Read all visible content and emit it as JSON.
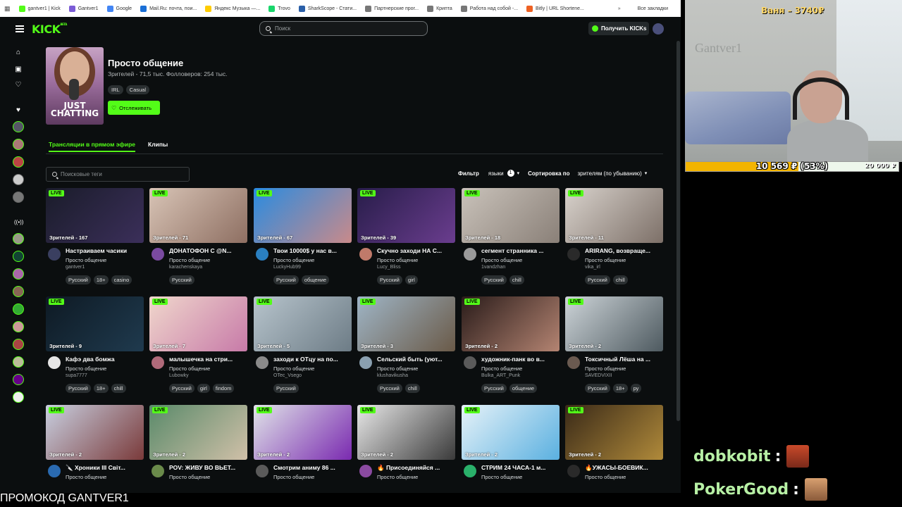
{
  "browser": {
    "bookmarks": [
      {
        "label": "gantver1 | Kick",
        "color": "#53fc18"
      },
      {
        "label": "Gantver1",
        "color": "#7b5cd6"
      },
      {
        "label": "Google",
        "color": "#4285f4"
      },
      {
        "label": "Mail.Ru: почта, пои...",
        "color": "#1a6fd6"
      },
      {
        "label": "Яндекс Музыка —...",
        "color": "#ffcc00"
      },
      {
        "label": "Trovo",
        "color": "#19d66b"
      },
      {
        "label": "SharkScope - Стати...",
        "color": "#2a5fa8"
      },
      {
        "label": "Партнерские прог...",
        "color": "#777777"
      },
      {
        "label": "Крипта",
        "color": "#777777"
      },
      {
        "label": "Работа над собой -...",
        "color": "#777777"
      },
      {
        "label": "Bitly | URL Shortene...",
        "color": "#ee6123"
      }
    ],
    "all_bookmarks": "Все закладки"
  },
  "header": {
    "search_placeholder": "Поиск",
    "kicks_button": "Получить KICKs"
  },
  "category": {
    "title": "Просто общение",
    "stats": "Зрителей - 71,5 тыс.  Фолловеров: 254 тыс.",
    "tags": [
      "IRL",
      "Casual"
    ],
    "follow_button": "Отслеживать",
    "image_text": "JUST CHATTING"
  },
  "tabs": {
    "live": "Трансляции в прямом эфире",
    "clips": "Клипы"
  },
  "filters": {
    "tag_search_placeholder": "Поисковые теги",
    "filter_label": "Фильтр",
    "languages_label": "языки",
    "languages_count": "1",
    "sort_label": "Сортировка по",
    "sort_value": "зрителям (по убыванию)"
  },
  "live_badge": "LIVE",
  "streams": [
    {
      "viewers": "Зрителей - 167",
      "title": "Настраиваем часики",
      "category": "Просто общение",
      "user": "gantver1",
      "tags": [
        "Русский",
        "18+",
        "casino"
      ],
      "thumb": [
        "#1a1c2a",
        "#3b2f5a"
      ],
      "avatar": "#3a3f60"
    },
    {
      "viewers": "Зрителей - 71",
      "title": "ДОНАТОФОН С @N...",
      "category": "Просто общение",
      "user": "karachenskaya",
      "tags": [
        "Русский"
      ],
      "thumb": [
        "#d8c4b6",
        "#8e6f62"
      ],
      "avatar": "#7a4aa0"
    },
    {
      "viewers": "Зрителей - 67",
      "title": "Твои 10000$ у нас в...",
      "category": "Просто общение",
      "user": "LuckyHub99",
      "tags": [
        "Русский",
        "общение"
      ],
      "thumb": [
        "#2a8be0",
        "#c98a8a"
      ],
      "avatar": "#2a7fc0"
    },
    {
      "viewers": "Зрителей - 39",
      "title": "Скучно заходи НА С...",
      "category": "Просто общение",
      "user": "Lucy_Bliss",
      "tags": [
        "Русский",
        "girl"
      ],
      "thumb": [
        "#281d4a",
        "#6a3d8e"
      ],
      "avatar": "#c07a6a"
    },
    {
      "viewers": "Зрителей - 18",
      "title": "сегмент странника ...",
      "category": "Просто общение",
      "user": "1vandzhan",
      "tags": [
        "Русский",
        "chill"
      ],
      "thumb": [
        "#c9c2ba",
        "#8a8078"
      ],
      "avatar": "#9a9a9a"
    },
    {
      "viewers": "Зрителей - 11",
      "title": "ARIRANG, возвраще...",
      "category": "Просто общение",
      "user": "vika_irl",
      "tags": [
        "Русский",
        "chill"
      ],
      "thumb": [
        "#d8d2cc",
        "#7d7068"
      ],
      "avatar": "#2a2a2a"
    },
    {
      "viewers": "Зрителей - 9",
      "title": "Кафэ два бомжа",
      "category": "Просто общение",
      "user": "supa7777",
      "tags": [
        "Русский",
        "18+",
        "chill"
      ],
      "thumb": [
        "#0e1a24",
        "#1f3a4e"
      ],
      "avatar": "#e6e6e6"
    },
    {
      "viewers": "Зрителей - 7",
      "title": "малышечка на стри...",
      "category": "Просто общение",
      "user": "Lubowky",
      "tags": [
        "Русский",
        "girl",
        "findom"
      ],
      "thumb": [
        "#f0d7cc",
        "#c77aa8"
      ],
      "avatar": "#b06a7a"
    },
    {
      "viewers": "Зрителей - 5",
      "title": "заходи к ОТцу на по...",
      "category": "Просто общение",
      "user": "OTec_Vsego",
      "tags": [
        "Русский"
      ],
      "thumb": [
        "#b7c4cc",
        "#6d7c86"
      ],
      "avatar": "#8a8a8a"
    },
    {
      "viewers": "Зрителей - 3",
      "title": "Сельский быть (уют...",
      "category": "Просто общение",
      "user": "klushavikusha",
      "tags": [
        "Русский",
        "chill"
      ],
      "thumb": [
        "#9fb5c6",
        "#6a5a48"
      ],
      "avatar": "#8aa0b0"
    },
    {
      "viewers": "Зрителей - 2",
      "title": "художник-панк во в...",
      "category": "Просто общение",
      "user": "Bulka_ART_Punk",
      "tags": [
        "Русский",
        "общение"
      ],
      "thumb": [
        "#2a1c1a",
        "#b48472"
      ],
      "avatar": "#5a5a5a"
    },
    {
      "viewers": "Зрителей - 2",
      "title": "Токсичный Лёша на ...",
      "category": "Просто общение",
      "user": "SAVEDVIXII",
      "tags": [
        "Русский",
        "18+",
        "ру"
      ],
      "thumb": [
        "#cdd4d8",
        "#4e5a60"
      ],
      "avatar": "#6a5a50"
    },
    {
      "viewers": "Зрителей - 2",
      "title": "🔪 Хроники III Світ...",
      "category": "Просто общение",
      "user": "",
      "tags": [],
      "thumb": [
        "#c8cfe0",
        "#7a3a3a"
      ],
      "avatar": "#2a6ab0"
    },
    {
      "viewers": "Зрителей - 2",
      "title": "POV: ЖИВУ ВО ВЬЕТ...",
      "category": "Просто общение",
      "user": "",
      "tags": [],
      "thumb": [
        "#5a8a6a",
        "#d0c0a8"
      ],
      "avatar": "#6a8a4a"
    },
    {
      "viewers": "Зрителей - 2",
      "title": "Смотрим аниму 86 ...",
      "category": "Просто общение",
      "user": "",
      "tags": [],
      "thumb": [
        "#e0e4e8",
        "#7a2ab0"
      ],
      "avatar": "#5a5a5a"
    },
    {
      "viewers": "Зрителей - 2",
      "title": "🔥 Присоединяйся ...",
      "category": "Просто общение",
      "user": "",
      "tags": [],
      "thumb": [
        "#e8e8e8",
        "#3a3a3a"
      ],
      "avatar": "#8a4aa0"
    },
    {
      "viewers": "Зрителей - 2",
      "title": "СТРИМ 24 ЧАСА-1 м...",
      "category": "Просто общение",
      "user": "",
      "tags": [],
      "thumb": [
        "#e6f2f8",
        "#5ab0e0"
      ],
      "avatar": "#2ab06a"
    },
    {
      "viewers": "Зрителей - 2",
      "title": "🔥УЖАСЫ-БОЕВИК...",
      "category": "Просто общение",
      "user": "",
      "tags": [],
      "thumb": [
        "#3a2a18",
        "#b08a3a"
      ],
      "avatar": "#2a2a2a"
    }
  ],
  "overlay": {
    "streamer": "Ваня – 3740₽",
    "webcam_wall_text": "Gantver1",
    "goal_text": "10 569 ₽ (53%)",
    "goal_target": "20 000 ₽",
    "goal_fraction": 0.53,
    "chat": [
      {
        "user": "dobkobit",
        "colon": ":"
      },
      {
        "user": "PokerGood",
        "colon": ":"
      }
    ],
    "promo": "ПРОМОКОД GANTVER1"
  },
  "colors": {
    "accent": "#53fc18",
    "background": "#0b0e0f"
  }
}
